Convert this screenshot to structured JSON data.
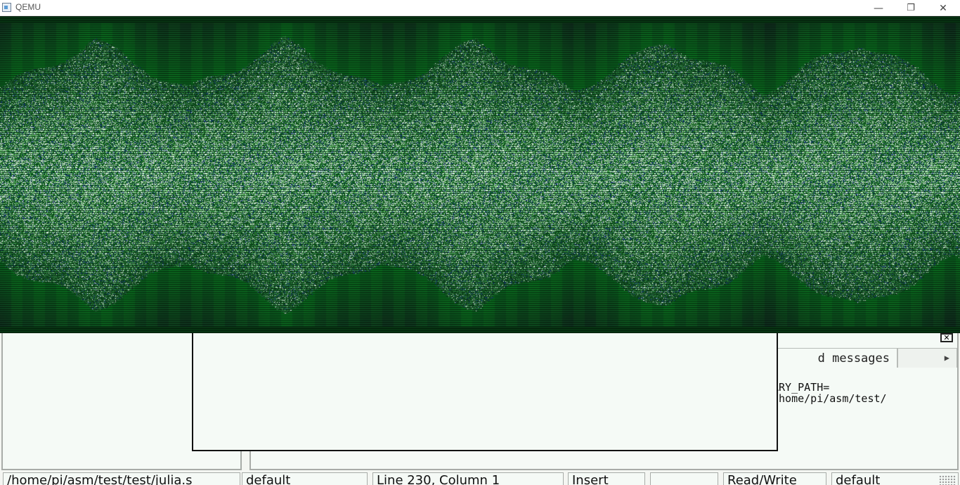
{
  "window": {
    "title": "QEMU",
    "controls": {
      "minimize": "—",
      "restore": "❐",
      "close": "✕"
    }
  },
  "messages_panel": {
    "tab_label": "d messages",
    "tab_arrow": "▶",
    "close_glyph": "✕",
    "lines": [
      "ARY_PATH=",
      "/home/pi/asm/test/"
    ]
  },
  "statusbar": {
    "file_path": "/home/pi/asm/test/test/julia.s",
    "encoding_profile": "default",
    "cursor_position": "Line 230, Column 1",
    "insert_mode": "Insert",
    "extra": "",
    "access_mode": "Read/Write",
    "syntax": "default"
  },
  "colors": {
    "fractal_dark": "#0a3a14",
    "fractal_mid": "#1f7a34",
    "fractal_light": "#bff0c8",
    "fractal_blue": "#1a3c8a",
    "pane_background": "#f5faf6"
  },
  "icons": {
    "app": "qemu-app-icon",
    "minimize": "minimize-icon",
    "restore": "restore-icon",
    "close": "close-icon",
    "panel_close": "panel-close-icon",
    "tab_scroll": "triangle-right-icon",
    "resize_grip": "resize-grip-icon"
  }
}
